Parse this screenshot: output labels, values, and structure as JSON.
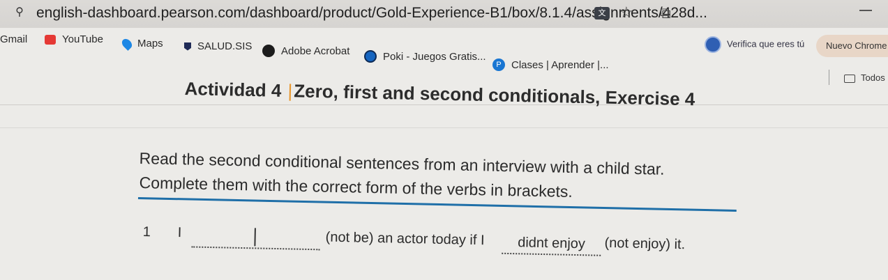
{
  "browser": {
    "site_info_icon": "tune-icon",
    "url": "english-dashboard.pearson.com/dashboard/product/Gold-Experience-B1/box/8.1.4/assignments/428d...",
    "translate_icon": "translate-icon",
    "star_icon": "star-icon",
    "extensions_icon": "extensions-icon",
    "profile_label": "Verifica que eres tú",
    "new_chrome_label": "Nuevo Chrome"
  },
  "bookmarks": [
    {
      "label": "Gmail",
      "icon": "gmail-icon"
    },
    {
      "label": "YouTube",
      "icon": "youtube-icon"
    },
    {
      "label": "Maps",
      "icon": "maps-icon"
    },
    {
      "label": "SALUD.SIS",
      "icon": "salud-icon"
    },
    {
      "label": "Adobe Acrobat",
      "icon": "adobe-icon"
    },
    {
      "label": "Poki - Juegos Gratis...",
      "icon": "poki-icon"
    },
    {
      "label": "Clases | Aprender |...",
      "icon": "clases-icon"
    }
  ],
  "all_bookmarks_label": "Todos l",
  "activity": {
    "title_prefix": "Actividad 4",
    "title_sep": "|",
    "title_main": "Zero, first and second conditionals, Exercise 4",
    "instruction_line1": "Read the second conditional sentences from an interview with a child star.",
    "instruction_line2": "Complete them with the correct form of the verbs in brackets."
  },
  "question_1": {
    "number": "1",
    "subject": "I",
    "answer1": "",
    "middle_text": "(not be) an actor today if I",
    "answer2": "didnt enjoy",
    "end_text": "(not enjoy) it."
  },
  "colors": {
    "accent_blue": "#1f6fa8",
    "title_separator": "#e8972e"
  }
}
